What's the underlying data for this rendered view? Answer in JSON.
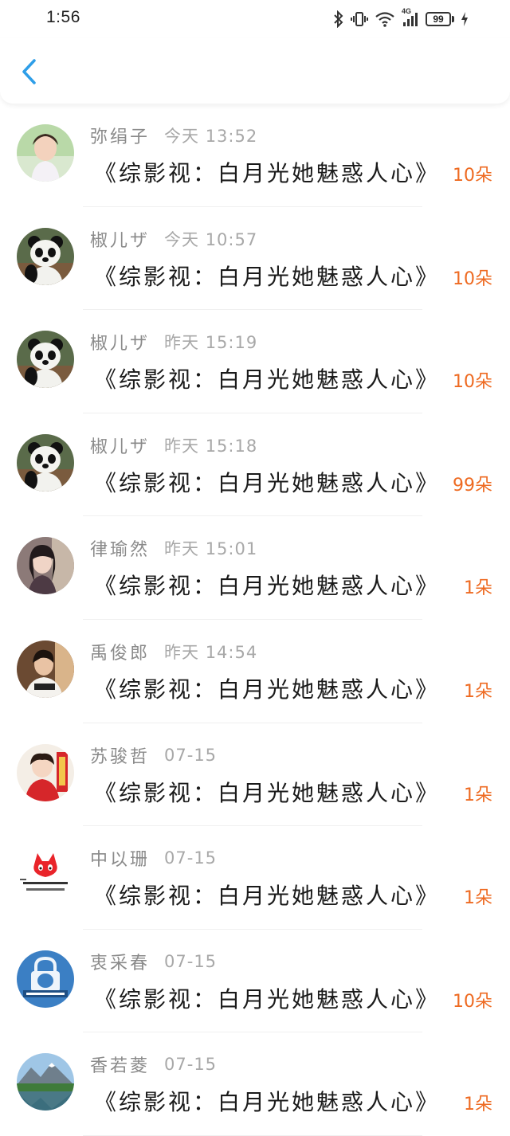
{
  "status_bar": {
    "time": "1:56",
    "battery": "99",
    "network": "4G",
    "icons": [
      "bluetooth-icon",
      "vibrate-icon",
      "wifi-icon",
      "signal-icon",
      "battery-icon",
      "charging-icon"
    ]
  },
  "header": {
    "back_icon": "chevron-left-icon",
    "accent_color": "#2e9ee8"
  },
  "colors": {
    "name": "#8a8a8a",
    "time": "#a8a8a8",
    "title": "#1a1a1a",
    "count": "#ee6a21"
  },
  "gifts": [
    {
      "name": "弥绢子",
      "time": "今天 13:52",
      "book": "《综影视：白月光她魅惑人心》",
      "count": "10朵",
      "avatar": "child-photo-avatar"
    },
    {
      "name": "椒儿ザ",
      "time": "今天 10:57",
      "book": "《综影视：白月光她魅惑人心》",
      "count": "10朵",
      "avatar": "panda-avatar"
    },
    {
      "name": "椒儿ザ",
      "time": "昨天 15:19",
      "book": "《综影视：白月光她魅惑人心》",
      "count": "10朵",
      "avatar": "panda-avatar"
    },
    {
      "name": "椒儿ザ",
      "time": "昨天 15:18",
      "book": "《综影视：白月光她魅惑人心》",
      "count": "99朵",
      "avatar": "panda-avatar"
    },
    {
      "name": "律瑜然",
      "time": "昨天 15:01",
      "book": "《综影视：白月光她魅惑人心》",
      "count": "1朵",
      "avatar": "girl-photo-avatar"
    },
    {
      "name": "禹俊郎",
      "time": "昨天 14:54",
      "book": "《综影视：白月光她魅惑人心》",
      "count": "1朵",
      "avatar": "boy-photo-avatar"
    },
    {
      "name": "苏骏哲",
      "time": "07-15",
      "book": "《综影视：白月光她魅惑人心》",
      "count": "1朵",
      "avatar": "festive-child-avatar"
    },
    {
      "name": "中以珊",
      "time": "07-15",
      "book": "《综影视：白月光她魅惑人心》",
      "count": "1朵",
      "avatar": "red-fox-avatar"
    },
    {
      "name": "衷采春",
      "time": "07-15",
      "book": "《综影视：白月光她魅惑人心》",
      "count": "10朵",
      "avatar": "bulldog-lock-avatar"
    },
    {
      "name": "香若菱",
      "time": "07-15",
      "book": "《综影视：白月光她魅惑人心》",
      "count": "1朵",
      "avatar": "mountain-lake-avatar"
    }
  ]
}
